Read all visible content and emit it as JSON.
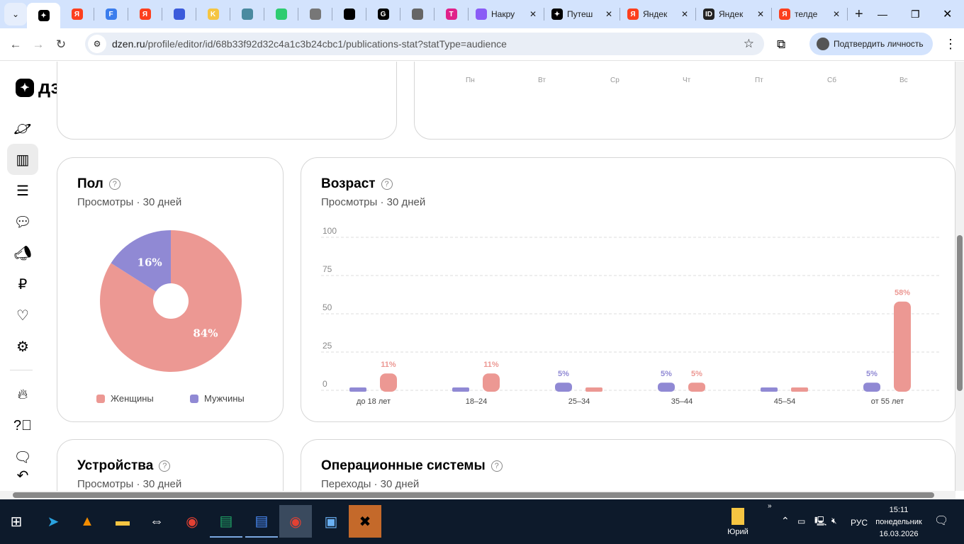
{
  "browser": {
    "tabs": [
      {
        "label": "",
        "icon": "dzen-icon"
      },
      {
        "label": "",
        "icon": "yandex-icon"
      },
      {
        "label": "",
        "icon": "f-icon"
      },
      {
        "label": "",
        "icon": "yandex-icon"
      },
      {
        "label": "",
        "icon": "wave-icon"
      },
      {
        "label": "",
        "icon": "k-icon"
      },
      {
        "label": "",
        "icon": "server-icon"
      },
      {
        "label": "",
        "icon": "dots-icon"
      },
      {
        "label": "",
        "icon": "figure-icon"
      },
      {
        "label": "",
        "icon": "ball-icon"
      },
      {
        "label": "",
        "icon": "gpt-icon"
      },
      {
        "label": "",
        "icon": "globe-icon"
      },
      {
        "label": "",
        "icon": "t-icon"
      },
      {
        "label": "Накру",
        "icon": "rocket-icon"
      },
      {
        "label": "Путеш",
        "icon": "dzen-icon"
      },
      {
        "label": "Яндек",
        "icon": "yandex-icon"
      },
      {
        "label": "Яндек",
        "icon": "id-icon"
      },
      {
        "label": "телде",
        "icon": "yandex-icon"
      }
    ],
    "url_domain": "dzen.ru",
    "url_path": "/profile/editor/id/68b33f92d32c4a1c3b24cbc1/publications-stat?statType=audience",
    "verify_label": "Подтвердить личность"
  },
  "header": {
    "logo": "дзен"
  },
  "top_card": {
    "weekdays": [
      "Пн",
      "Вт",
      "Ср",
      "Чт",
      "Пт",
      "Сб",
      "Вс"
    ]
  },
  "gender": {
    "title": "Пол",
    "subtitle": "Просмотры · 30 дней",
    "legend": [
      "Женщины",
      "Мужчины"
    ]
  },
  "age": {
    "title": "Возраст",
    "subtitle": "Просмотры · 30 дней"
  },
  "devices": {
    "title": "Устройства",
    "subtitle": "Просмотры · 30 дней"
  },
  "os": {
    "title": "Операционные системы",
    "subtitle": "Переходы · 30 дней"
  },
  "chart_data": [
    {
      "type": "pie",
      "title": "Пол",
      "slices": [
        {
          "label": "Женщины",
          "value": 84,
          "text": "84%",
          "color": "#ec9893"
        },
        {
          "label": "Мужчины",
          "value": 16,
          "text": "16%",
          "color": "#9089d4"
        }
      ]
    },
    {
      "type": "bar",
      "title": "Возраст",
      "categories": [
        "до 18 лет",
        "18–24",
        "25–34",
        "35–44",
        "45–54",
        "от 55 лет"
      ],
      "yticks": [
        "0",
        "25",
        "50",
        "75",
        "100"
      ],
      "ylim": [
        0,
        100
      ],
      "series": [
        {
          "name": "Мужчины",
          "color": "#9089d4",
          "values": [
            1,
            1,
            5,
            5,
            1,
            5
          ],
          "labels": [
            "",
            "",
            "5%",
            "5%",
            "",
            "5%"
          ]
        },
        {
          "name": "Женщины",
          "color": "#ec9893",
          "values": [
            11,
            11,
            1,
            5,
            1,
            58
          ],
          "labels": [
            "11%",
            "11%",
            "",
            "5%",
            "",
            "58%"
          ]
        }
      ]
    }
  ],
  "taskbar": {
    "user": "Юрий",
    "lang": "РУС",
    "time": "15:11",
    "day": "понедельник",
    "date": "16.03.2026"
  }
}
